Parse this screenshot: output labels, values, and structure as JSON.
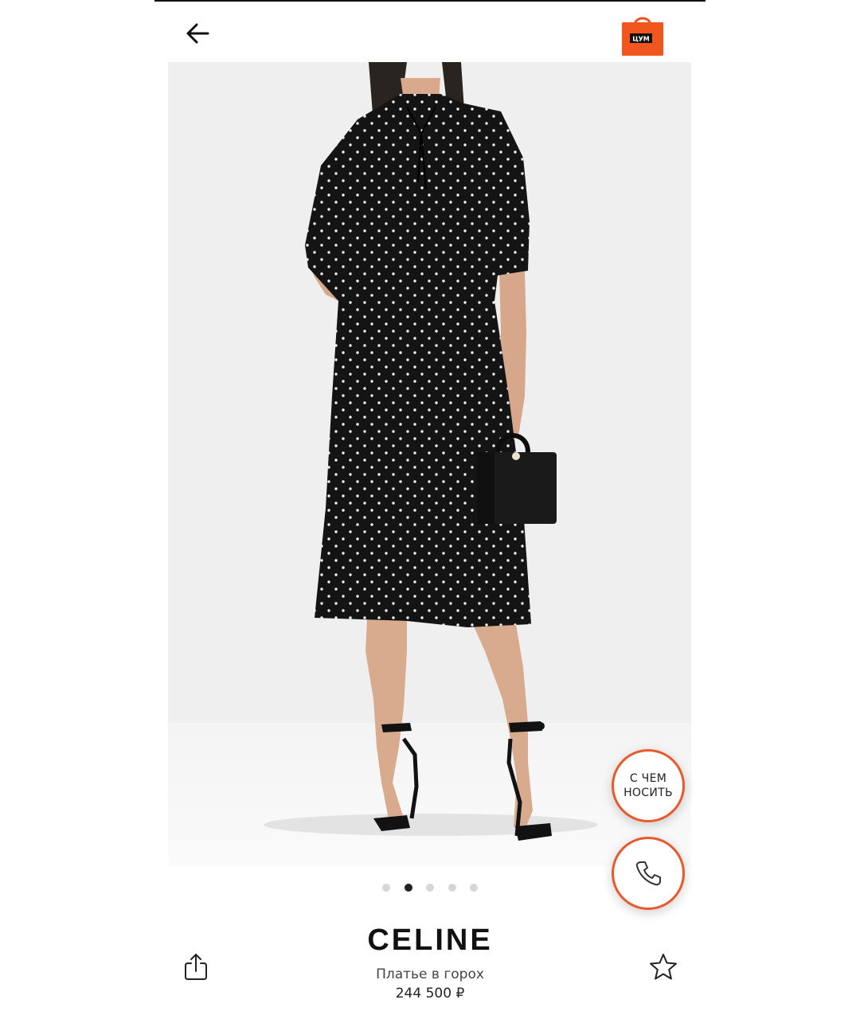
{
  "header": {
    "back_icon": "arrow-left-icon",
    "bag_icon": "shopping-bag-icon",
    "bag_logo_text": "ЦУМ",
    "accent_color": "#f0561e"
  },
  "gallery": {
    "image": "product-photo",
    "image_count": 5,
    "active_index": 1
  },
  "floating": {
    "what_to_wear_label": "С ЧЕМ\nНОСИТЬ",
    "call_icon": "phone-icon",
    "ring_color": "#e85a2b"
  },
  "product": {
    "brand": "CELINE",
    "name": "Платье в горох",
    "price": "244 500 ₽"
  },
  "actions": {
    "share_icon": "share-icon",
    "favorite_icon": "star-icon"
  }
}
